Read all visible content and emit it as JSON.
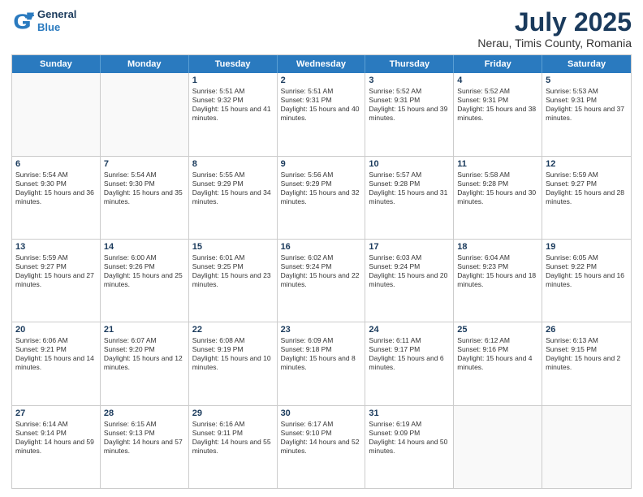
{
  "header": {
    "logo_line1": "General",
    "logo_line2": "Blue",
    "month": "July 2025",
    "location": "Nerau, Timis County, Romania"
  },
  "days_of_week": [
    "Sunday",
    "Monday",
    "Tuesday",
    "Wednesday",
    "Thursday",
    "Friday",
    "Saturday"
  ],
  "weeks": [
    [
      {
        "day": "",
        "text": ""
      },
      {
        "day": "",
        "text": ""
      },
      {
        "day": "1",
        "text": "Sunrise: 5:51 AM\nSunset: 9:32 PM\nDaylight: 15 hours and 41 minutes."
      },
      {
        "day": "2",
        "text": "Sunrise: 5:51 AM\nSunset: 9:31 PM\nDaylight: 15 hours and 40 minutes."
      },
      {
        "day": "3",
        "text": "Sunrise: 5:52 AM\nSunset: 9:31 PM\nDaylight: 15 hours and 39 minutes."
      },
      {
        "day": "4",
        "text": "Sunrise: 5:52 AM\nSunset: 9:31 PM\nDaylight: 15 hours and 38 minutes."
      },
      {
        "day": "5",
        "text": "Sunrise: 5:53 AM\nSunset: 9:31 PM\nDaylight: 15 hours and 37 minutes."
      }
    ],
    [
      {
        "day": "6",
        "text": "Sunrise: 5:54 AM\nSunset: 9:30 PM\nDaylight: 15 hours and 36 minutes."
      },
      {
        "day": "7",
        "text": "Sunrise: 5:54 AM\nSunset: 9:30 PM\nDaylight: 15 hours and 35 minutes."
      },
      {
        "day": "8",
        "text": "Sunrise: 5:55 AM\nSunset: 9:29 PM\nDaylight: 15 hours and 34 minutes."
      },
      {
        "day": "9",
        "text": "Sunrise: 5:56 AM\nSunset: 9:29 PM\nDaylight: 15 hours and 32 minutes."
      },
      {
        "day": "10",
        "text": "Sunrise: 5:57 AM\nSunset: 9:28 PM\nDaylight: 15 hours and 31 minutes."
      },
      {
        "day": "11",
        "text": "Sunrise: 5:58 AM\nSunset: 9:28 PM\nDaylight: 15 hours and 30 minutes."
      },
      {
        "day": "12",
        "text": "Sunrise: 5:59 AM\nSunset: 9:27 PM\nDaylight: 15 hours and 28 minutes."
      }
    ],
    [
      {
        "day": "13",
        "text": "Sunrise: 5:59 AM\nSunset: 9:27 PM\nDaylight: 15 hours and 27 minutes."
      },
      {
        "day": "14",
        "text": "Sunrise: 6:00 AM\nSunset: 9:26 PM\nDaylight: 15 hours and 25 minutes."
      },
      {
        "day": "15",
        "text": "Sunrise: 6:01 AM\nSunset: 9:25 PM\nDaylight: 15 hours and 23 minutes."
      },
      {
        "day": "16",
        "text": "Sunrise: 6:02 AM\nSunset: 9:24 PM\nDaylight: 15 hours and 22 minutes."
      },
      {
        "day": "17",
        "text": "Sunrise: 6:03 AM\nSunset: 9:24 PM\nDaylight: 15 hours and 20 minutes."
      },
      {
        "day": "18",
        "text": "Sunrise: 6:04 AM\nSunset: 9:23 PM\nDaylight: 15 hours and 18 minutes."
      },
      {
        "day": "19",
        "text": "Sunrise: 6:05 AM\nSunset: 9:22 PM\nDaylight: 15 hours and 16 minutes."
      }
    ],
    [
      {
        "day": "20",
        "text": "Sunrise: 6:06 AM\nSunset: 9:21 PM\nDaylight: 15 hours and 14 minutes."
      },
      {
        "day": "21",
        "text": "Sunrise: 6:07 AM\nSunset: 9:20 PM\nDaylight: 15 hours and 12 minutes."
      },
      {
        "day": "22",
        "text": "Sunrise: 6:08 AM\nSunset: 9:19 PM\nDaylight: 15 hours and 10 minutes."
      },
      {
        "day": "23",
        "text": "Sunrise: 6:09 AM\nSunset: 9:18 PM\nDaylight: 15 hours and 8 minutes."
      },
      {
        "day": "24",
        "text": "Sunrise: 6:11 AM\nSunset: 9:17 PM\nDaylight: 15 hours and 6 minutes."
      },
      {
        "day": "25",
        "text": "Sunrise: 6:12 AM\nSunset: 9:16 PM\nDaylight: 15 hours and 4 minutes."
      },
      {
        "day": "26",
        "text": "Sunrise: 6:13 AM\nSunset: 9:15 PM\nDaylight: 15 hours and 2 minutes."
      }
    ],
    [
      {
        "day": "27",
        "text": "Sunrise: 6:14 AM\nSunset: 9:14 PM\nDaylight: 14 hours and 59 minutes."
      },
      {
        "day": "28",
        "text": "Sunrise: 6:15 AM\nSunset: 9:13 PM\nDaylight: 14 hours and 57 minutes."
      },
      {
        "day": "29",
        "text": "Sunrise: 6:16 AM\nSunset: 9:11 PM\nDaylight: 14 hours and 55 minutes."
      },
      {
        "day": "30",
        "text": "Sunrise: 6:17 AM\nSunset: 9:10 PM\nDaylight: 14 hours and 52 minutes."
      },
      {
        "day": "31",
        "text": "Sunrise: 6:19 AM\nSunset: 9:09 PM\nDaylight: 14 hours and 50 minutes."
      },
      {
        "day": "",
        "text": ""
      },
      {
        "day": "",
        "text": ""
      }
    ]
  ]
}
